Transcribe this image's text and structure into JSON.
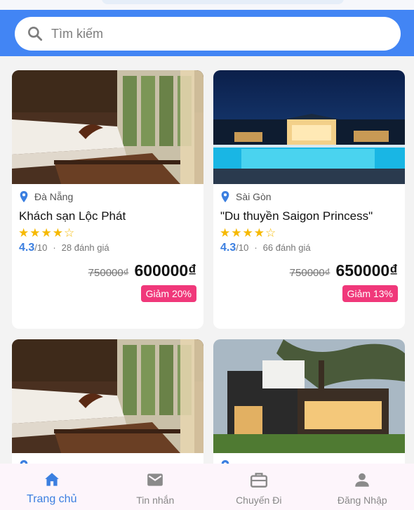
{
  "search": {
    "placeholder": "Tìm kiếm"
  },
  "cards": [
    {
      "location": "Đà Nẵng",
      "name": "Khách sạn Lộc Phát",
      "stars": "★★★★",
      "stars_empty": "☆",
      "score": "4.3",
      "score_max": "/10",
      "separator": "·",
      "reviews": "28 đánh giá",
      "old_price": "750000₫",
      "new_price": "600000₫",
      "discount": "Giảm 20%"
    },
    {
      "location": "Sài Gòn",
      "name": "\"Du thuyền Saigon Princess\"",
      "stars": "★★★★",
      "stars_empty": "☆",
      "score": "4.3",
      "score_max": "/10",
      "separator": "·",
      "reviews": "66 đánh giá",
      "old_price": "750000₫",
      "new_price": "650000₫",
      "discount": "Giảm 13%"
    }
  ],
  "bottom_nav": [
    {
      "label": "Trang chủ",
      "icon": "home-icon",
      "active": true
    },
    {
      "label": "Tin nhắn",
      "icon": "mail-icon",
      "active": false
    },
    {
      "label": "Chuyến Đi",
      "icon": "briefcase-icon",
      "active": false
    },
    {
      "label": "Đăng Nhập",
      "icon": "person-icon",
      "active": false
    }
  ],
  "colors": {
    "header": "#4285f4",
    "accent": "#3b7fe0",
    "star": "#f6b900",
    "badge": "#f0387a",
    "nav_bg": "#fdf5fb"
  }
}
